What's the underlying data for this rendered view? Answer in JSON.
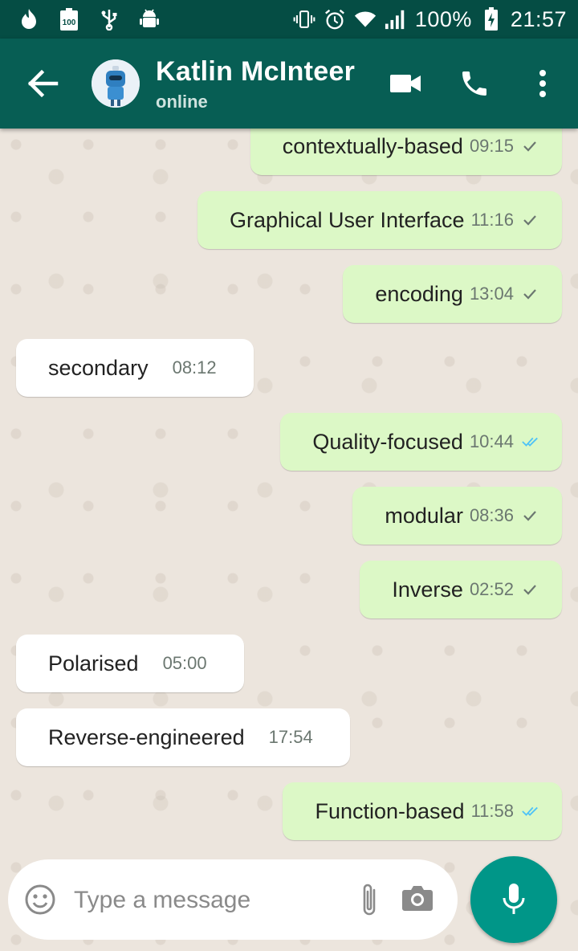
{
  "status_bar": {
    "battery_percent": "100%",
    "time": "21:57",
    "battery_label": "100"
  },
  "header": {
    "contact_name": "Katlin McInteer",
    "contact_status": "online"
  },
  "colors": {
    "status_bar": "#054d44",
    "app_bar": "#075e54",
    "outgoing_bubble": "#dcf8c6",
    "incoming_bubble": "#ffffff",
    "mic_button": "#009688",
    "read_tick": "#4fc3f7"
  },
  "messages": [
    {
      "direction": "out",
      "text": "contextually-based",
      "time": "09:15",
      "status": "sent"
    },
    {
      "direction": "out",
      "text": "Graphical User Interface",
      "time": "11:16",
      "status": "sent"
    },
    {
      "direction": "out",
      "text": "encoding",
      "time": "13:04",
      "status": "sent"
    },
    {
      "direction": "in",
      "text": "secondary",
      "time": "08:12"
    },
    {
      "direction": "out",
      "text": "Quality-focused",
      "time": "10:44",
      "status": "read"
    },
    {
      "direction": "out",
      "text": "modular",
      "time": "08:36",
      "status": "sent"
    },
    {
      "direction": "out",
      "text": "Inverse",
      "time": "02:52",
      "status": "sent"
    },
    {
      "direction": "in",
      "text": "Polarised",
      "time": "05:00"
    },
    {
      "direction": "in",
      "text": "Reverse-engineered",
      "time": "17:54"
    },
    {
      "direction": "out",
      "text": "Function-based",
      "time": "11:58",
      "status": "read"
    }
  ],
  "composer": {
    "placeholder": "Type a message"
  }
}
